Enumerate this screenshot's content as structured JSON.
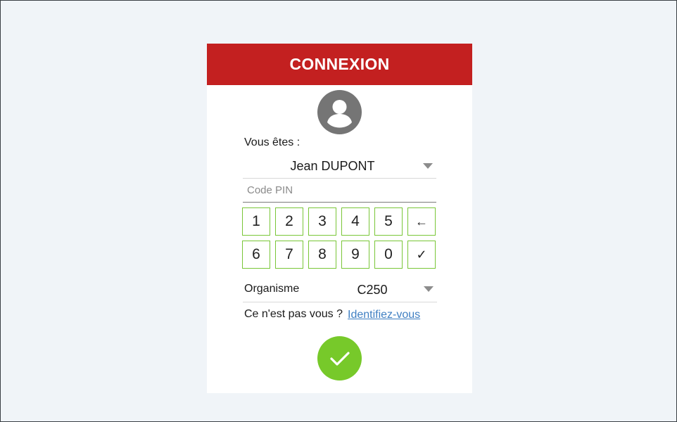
{
  "header": {
    "title": "CONNEXION"
  },
  "user": {
    "label": "Vous êtes :",
    "selected": "Jean DUPONT"
  },
  "pin": {
    "placeholder": "Code PIN",
    "value": ""
  },
  "keypad": {
    "keys": [
      "1",
      "2",
      "3",
      "4",
      "5",
      "←",
      "6",
      "7",
      "8",
      "9",
      "0",
      "✓"
    ]
  },
  "organization": {
    "label": "Organisme",
    "selected": "C250"
  },
  "identify": {
    "prompt": "Ce n'est pas vous ?",
    "link": "Identifiez-vous"
  },
  "icons": {
    "avatar": "user-circle-icon",
    "dropdown": "caret-down-icon",
    "submit": "checkmark-icon"
  },
  "colors": {
    "header": "#c32020",
    "accent_green": "#77c92a",
    "key_border": "#79c637",
    "link": "#3f7fc2",
    "background": "#f0f4f8"
  }
}
